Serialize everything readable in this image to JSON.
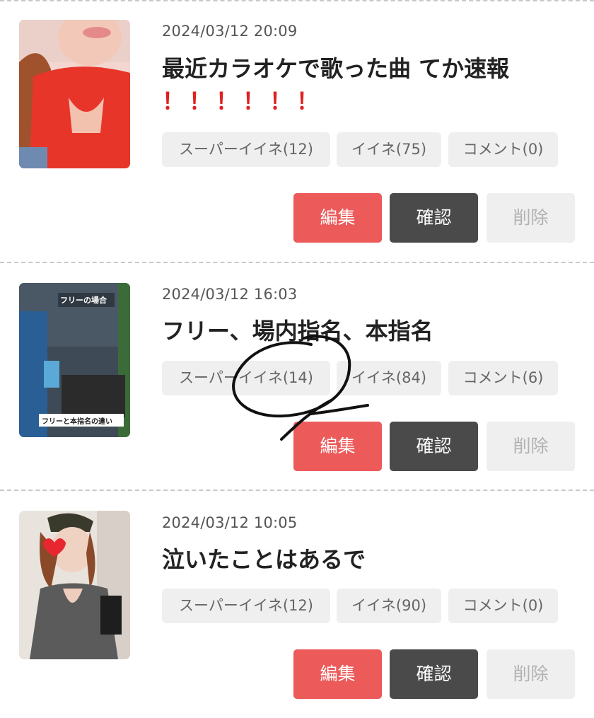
{
  "posts": [
    {
      "date": "2024/03/12 20:09",
      "title": "最近カラオケで歌った曲 てか速報",
      "title_marks": "！！！！！！",
      "super_like": "スーパーイイネ(12)",
      "like": "イイネ(75)",
      "comment": "コメント(0)",
      "edit": "編集",
      "confirm": "確認",
      "delete": "削除"
    },
    {
      "date": "2024/03/12 16:03",
      "title": "フリー、場内指名、本指名",
      "thumb_caption_top": "フリーの場合",
      "thumb_caption_bottom": "フリーと本指名の違い",
      "super_like": "スーパーイイネ(14)",
      "like": "イイネ(84)",
      "comment": "コメント(6)",
      "edit": "編集",
      "confirm": "確認",
      "delete": "削除"
    },
    {
      "date": "2024/03/12 10:05",
      "title": "泣いたことはあるで",
      "super_like": "スーパーイイネ(12)",
      "like": "イイネ(90)",
      "comment": "コメント(0)",
      "edit": "編集",
      "confirm": "確認",
      "delete": "削除"
    }
  ],
  "colors": {
    "edit_bg": "#ec5a5a",
    "confirm_bg": "#4a4a4a",
    "delete_bg": "#efefef",
    "pill_bg": "#efefef",
    "exclamation": "#e02020"
  }
}
